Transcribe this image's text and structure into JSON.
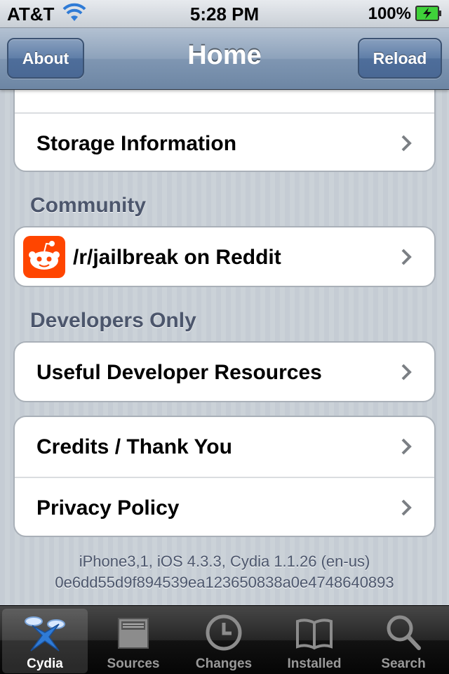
{
  "status": {
    "carrier": "AT&T",
    "time": "5:28 PM",
    "battery": "100%"
  },
  "nav": {
    "title": "Home",
    "left_button": "About",
    "right_button": "Reload"
  },
  "groups": {
    "top": [
      {
        "label": "Storage Information"
      }
    ],
    "community": {
      "header": "Community",
      "items": [
        {
          "label": "/r/jailbreak on Reddit",
          "icon": "reddit-icon"
        }
      ]
    },
    "developers": {
      "header": "Developers Only",
      "items": [
        {
          "label": "Useful Developer Resources"
        }
      ]
    },
    "misc": [
      {
        "label": "Credits / Thank You"
      },
      {
        "label": "Privacy Policy"
      }
    ]
  },
  "footer": {
    "device_line": "iPhone3,1, iOS 4.3.3, Cydia 1.1.26 (en-us)",
    "udid": "0e6dd55d9f894539ea123650838a0e4748640893"
  },
  "tabs": [
    {
      "label": "Cydia",
      "icon": "cydia-icon",
      "active": true
    },
    {
      "label": "Sources",
      "icon": "sources-box-icon",
      "active": false
    },
    {
      "label": "Changes",
      "icon": "clock-icon",
      "active": false
    },
    {
      "label": "Installed",
      "icon": "book-icon",
      "active": false
    },
    {
      "label": "Search",
      "icon": "magnifier-icon",
      "active": false
    }
  ],
  "colors": {
    "nav_tint": "#6d86a4",
    "section_text": "#4c566c",
    "reddit": "#ff4500",
    "battery_green": "#3fd23a"
  }
}
